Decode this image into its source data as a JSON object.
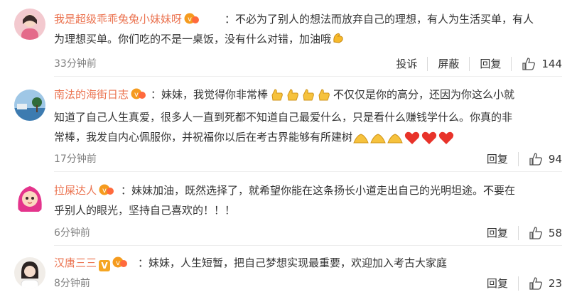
{
  "comments": [
    {
      "username": "我是超级乖乖兔兔小妹妹呀",
      "text_lines": [
        "：不必为了别人的想法而放弃自己的理想，有人为生活买单，有人",
        "为理想买单。你们吃的不是一桌饭，没有什么对错，加油哦"
      ],
      "trailing_emoji": "muscle-emoji",
      "time": "33分钟前",
      "actions": [
        "投诉",
        "屏蔽",
        "回复"
      ],
      "likes": "144",
      "avatar": "avatar-girl-pink"
    },
    {
      "username": "南法的海街日志",
      "text_lines": [
        "：妹妹，我觉得你非常棒",
        "不仅仅是你的高分，还因为你这么小就",
        "知道了自己人生真爱，很多人一直到死都不知道自己最爱什么，只是看什么赚钱学什么。你真的非",
        "常棒，我发自内心佩服你，并祝福你以后在考古界能够有所建树"
      ],
      "emojis_after_line1": [
        "thumbs-up-emoji",
        "thumbs-up-emoji",
        "thumbs-up-emoji",
        "thumbs-up-emoji"
      ],
      "emojis_end": [
        "pray-emoji",
        "pray-emoji",
        "pray-emoji",
        "heart-emoji",
        "heart-emoji",
        "heart-emoji"
      ],
      "time": "17分钟前",
      "actions": [
        "回复"
      ],
      "likes": "94",
      "avatar": "avatar-sea"
    },
    {
      "username": "拉屎达人",
      "text_lines": [
        "：妹妹加油，既然选择了，就希望你能在这条扬长小道走出自己的光明坦途。不要在",
        "乎别人的眼光，坚持自己喜欢的！！！"
      ],
      "time": "6分钟前",
      "actions": [
        "回复"
      ],
      "likes": "58",
      "avatar": "avatar-cartoon-pink-hair"
    },
    {
      "username": "汉唐三三",
      "verified": "V",
      "text_lines": [
        "：妹妹，人生短暂，把自己梦想实现最重要，欢迎加入考古大家庭"
      ],
      "time": "8分钟前",
      "actions": [
        "回复"
      ],
      "likes": "23",
      "avatar": "avatar-portrait"
    }
  ],
  "colors": {
    "username": "#eb7350",
    "time": "#808080",
    "text": "#333333",
    "badge": "#f5a623"
  }
}
